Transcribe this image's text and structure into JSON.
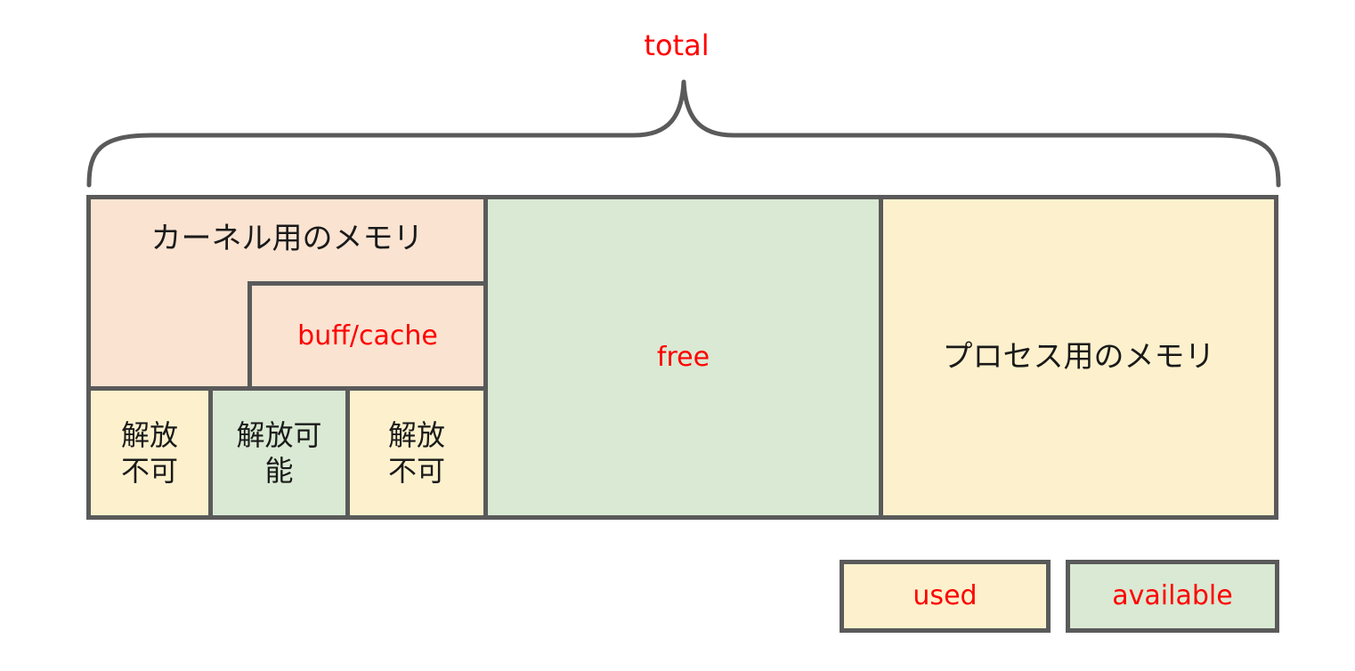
{
  "diagram": {
    "total_label": "total",
    "kernel_label": "カーネル用のメモリ",
    "buffcache_label": "buff/cache",
    "free_label": "free",
    "process_label": "プロセス用のメモリ",
    "cell_non_freeable_left": "解放\n不可",
    "cell_freeable": "解放可\n能",
    "cell_non_freeable_right": "解放\n不可"
  },
  "legend": {
    "used_label": "used",
    "available_label": "available"
  },
  "colors": {
    "kernel_bg": "#fae3d1",
    "used_bg": "#fdf1cd",
    "available_bg": "#d9e9d3",
    "border": "#5a5a5a",
    "highlight_text": "#ff0000"
  }
}
